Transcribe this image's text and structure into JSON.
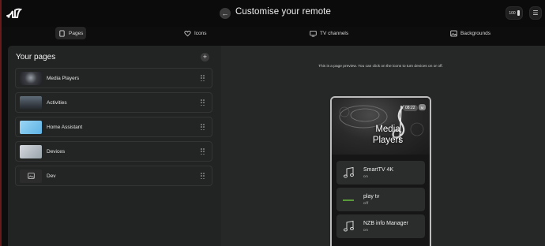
{
  "header": {
    "title": "Customise your remote",
    "battery_level": "100"
  },
  "tabs": [
    {
      "label": "Pages",
      "icon": "pages-icon",
      "active": true
    },
    {
      "label": "Icons",
      "icon": "heart-icon",
      "active": false
    },
    {
      "label": "TV channels",
      "icon": "tv-icon",
      "active": false
    },
    {
      "label": "Backgrounds",
      "icon": "image-icon",
      "active": false
    }
  ],
  "pages_panel": {
    "title": "Your pages",
    "items": [
      {
        "label": "Media Players",
        "thumb": "#2e3036"
      },
      {
        "label": "Activities",
        "thumb": "#4a5560"
      },
      {
        "label": "Home Assistant",
        "thumb": "#7fc7ee"
      },
      {
        "label": "Devices",
        "thumb": "#b8c0c8"
      },
      {
        "label": "Dev",
        "thumb": "#2c2c2c"
      }
    ]
  },
  "preview": {
    "hint": "This is a page preview. You can click on the icons to turn devices on or off.",
    "page_title": "Media Players",
    "time": "08:22",
    "devices": [
      {
        "name": "SmartTV 4K",
        "state": "on",
        "icon": "music-note-icon"
      },
      {
        "name": "play tv",
        "state": "off",
        "icon": "line-icon"
      },
      {
        "name": "NZB info Manager",
        "state": "on",
        "icon": "music-note-icon"
      }
    ]
  },
  "colors": {
    "background": "#0d0d0d",
    "panel": "#222423",
    "preview_panel": "#262827",
    "row_border": "#343434",
    "accent_line": "#5a9a3a"
  }
}
